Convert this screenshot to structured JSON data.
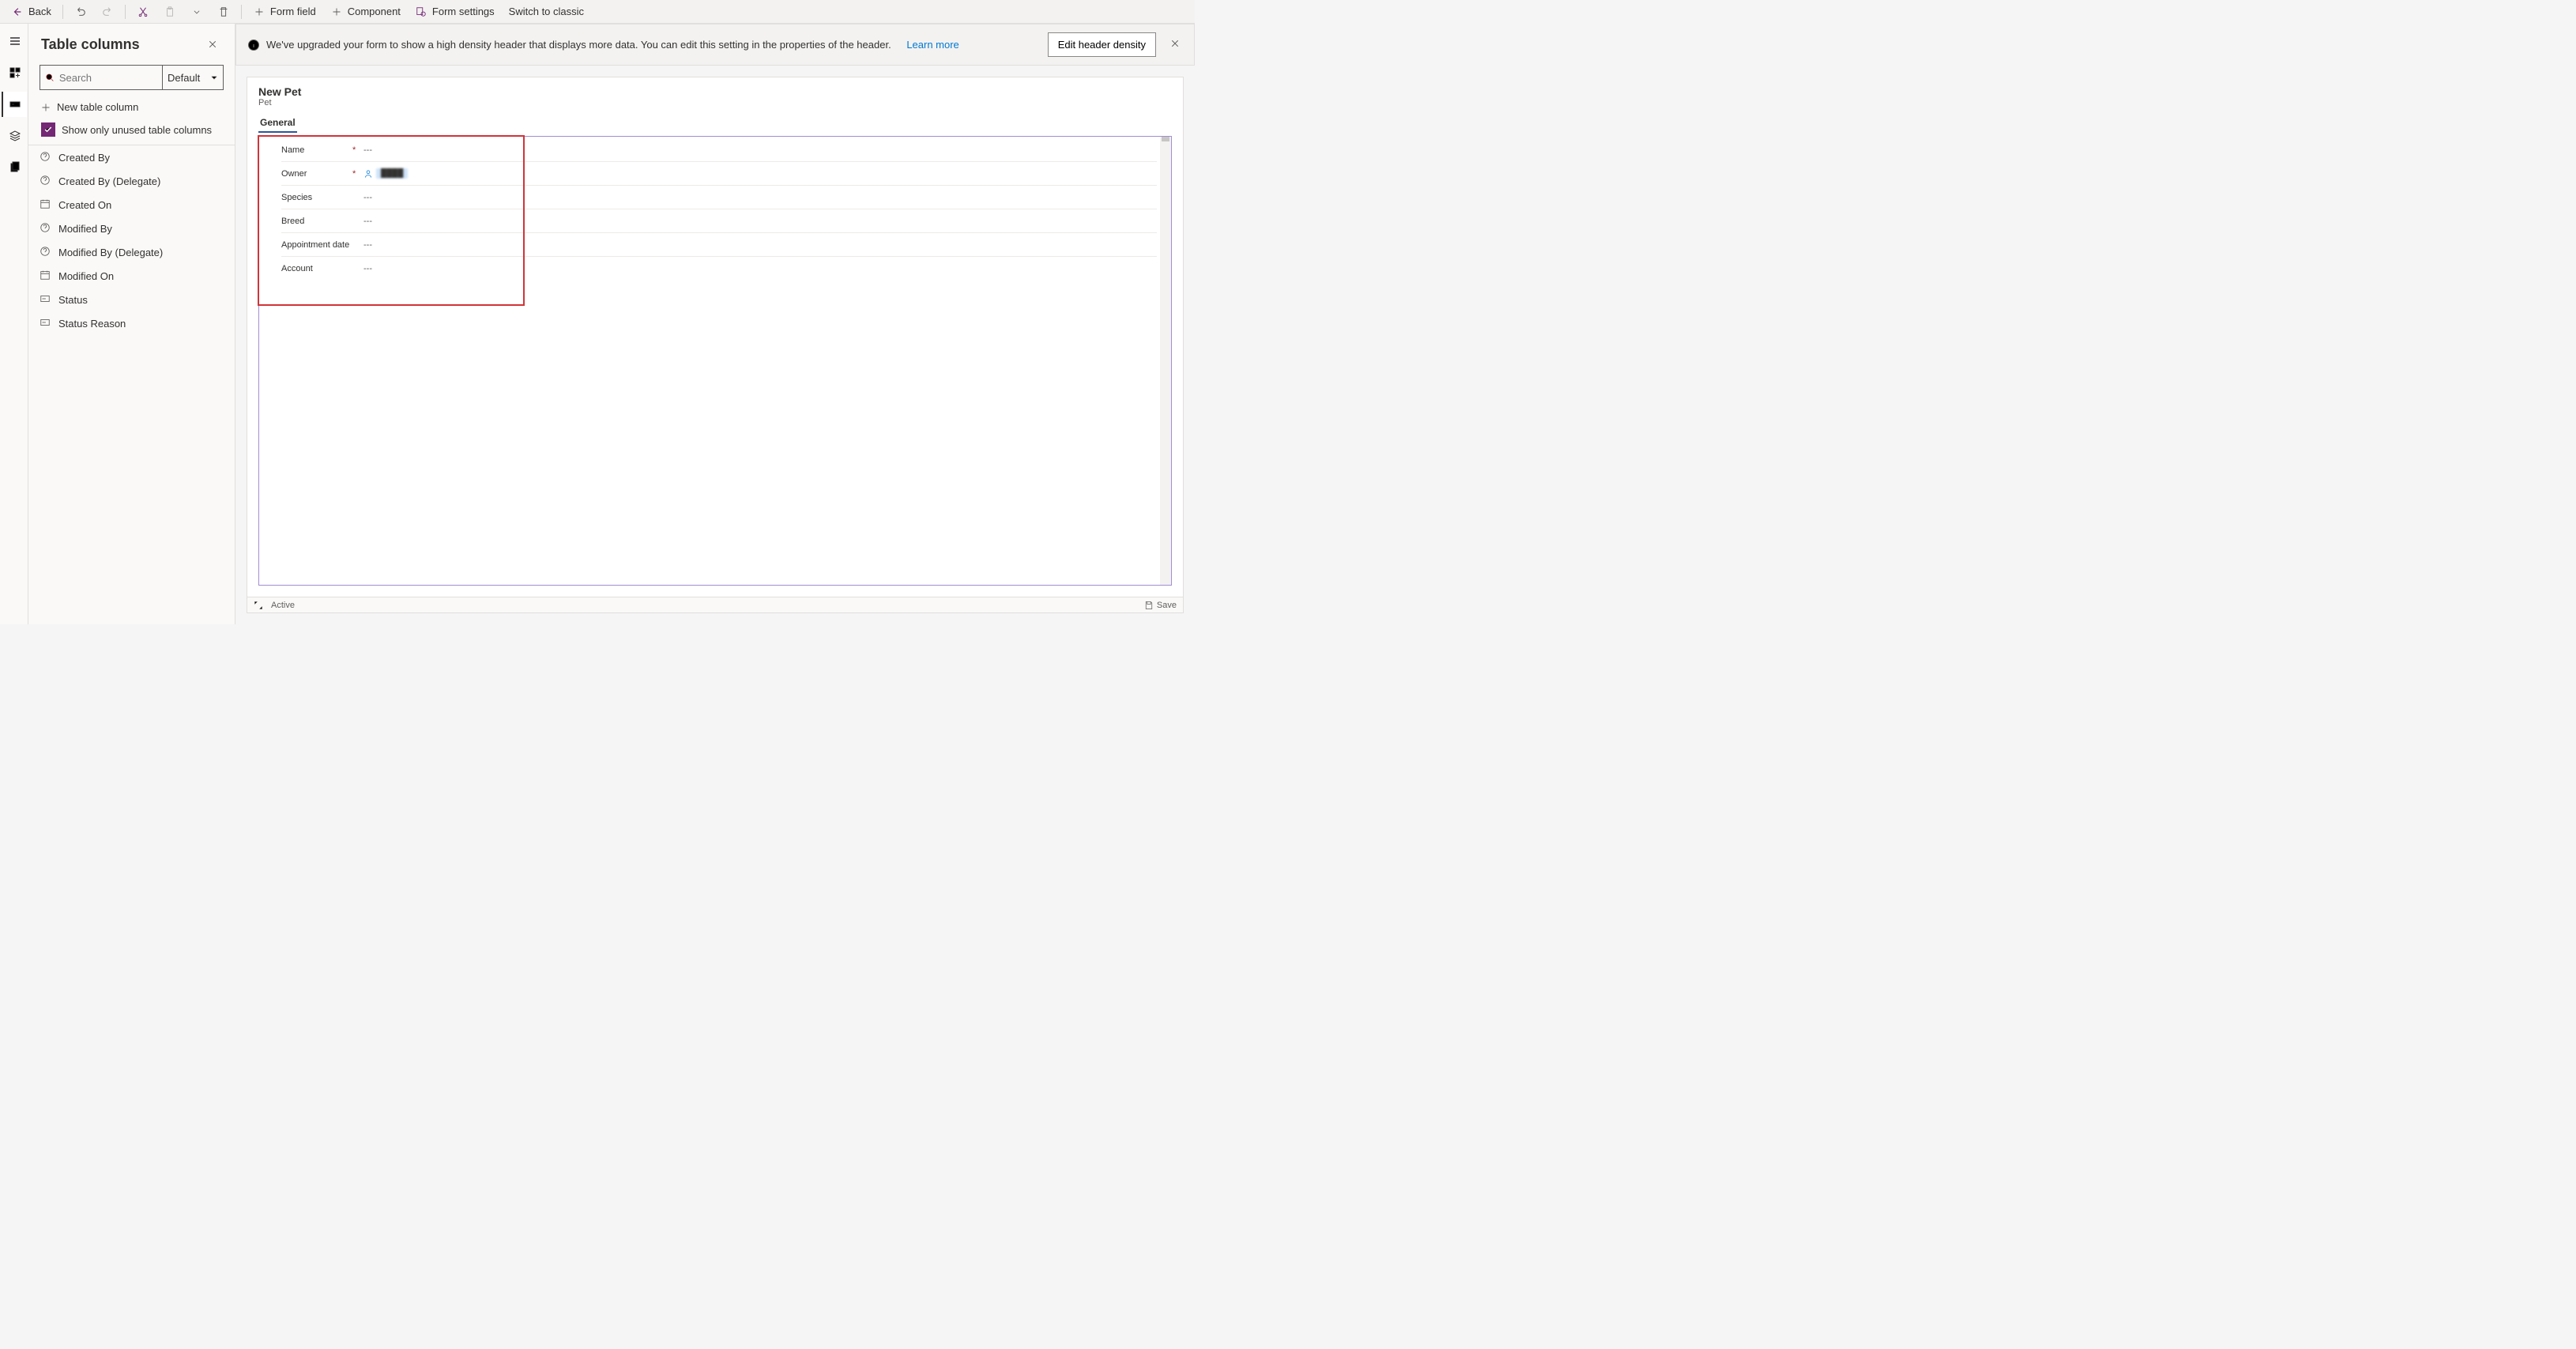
{
  "toolbar": {
    "back": "Back",
    "form_field": "Form field",
    "component": "Component",
    "form_settings": "Form settings",
    "switch_classic": "Switch to classic"
  },
  "panel": {
    "title": "Table columns",
    "search_placeholder": "Search",
    "filter_label": "Default",
    "new_column": "New table column",
    "show_only_unused": "Show only unused table columns",
    "columns": [
      {
        "icon": "question",
        "label": "Created By"
      },
      {
        "icon": "question",
        "label": "Created By (Delegate)"
      },
      {
        "icon": "calendar",
        "label": "Created On"
      },
      {
        "icon": "question",
        "label": "Modified By"
      },
      {
        "icon": "question",
        "label": "Modified By (Delegate)"
      },
      {
        "icon": "calendar",
        "label": "Modified On"
      },
      {
        "icon": "choice",
        "label": "Status"
      },
      {
        "icon": "choice",
        "label": "Status Reason"
      }
    ]
  },
  "banner": {
    "text": "We've upgraded your form to show a high density header that displays more data. You can edit this setting in the properties of the header.",
    "link": "Learn more",
    "button": "Edit header density"
  },
  "form": {
    "title": "New Pet",
    "subtitle": "Pet",
    "tab": "General",
    "fields": [
      {
        "label": "Name",
        "required": true,
        "value": "---",
        "type": "text"
      },
      {
        "label": "Owner",
        "required": true,
        "value": "",
        "type": "owner"
      },
      {
        "label": "Species",
        "required": false,
        "value": "---",
        "type": "text"
      },
      {
        "label": "Breed",
        "required": false,
        "value": "---",
        "type": "text"
      },
      {
        "label": "Appointment date",
        "required": false,
        "value": "---",
        "type": "text"
      },
      {
        "label": "Account",
        "required": false,
        "value": "---",
        "type": "text"
      }
    ],
    "status_text": "Active",
    "save_text": "Save"
  }
}
